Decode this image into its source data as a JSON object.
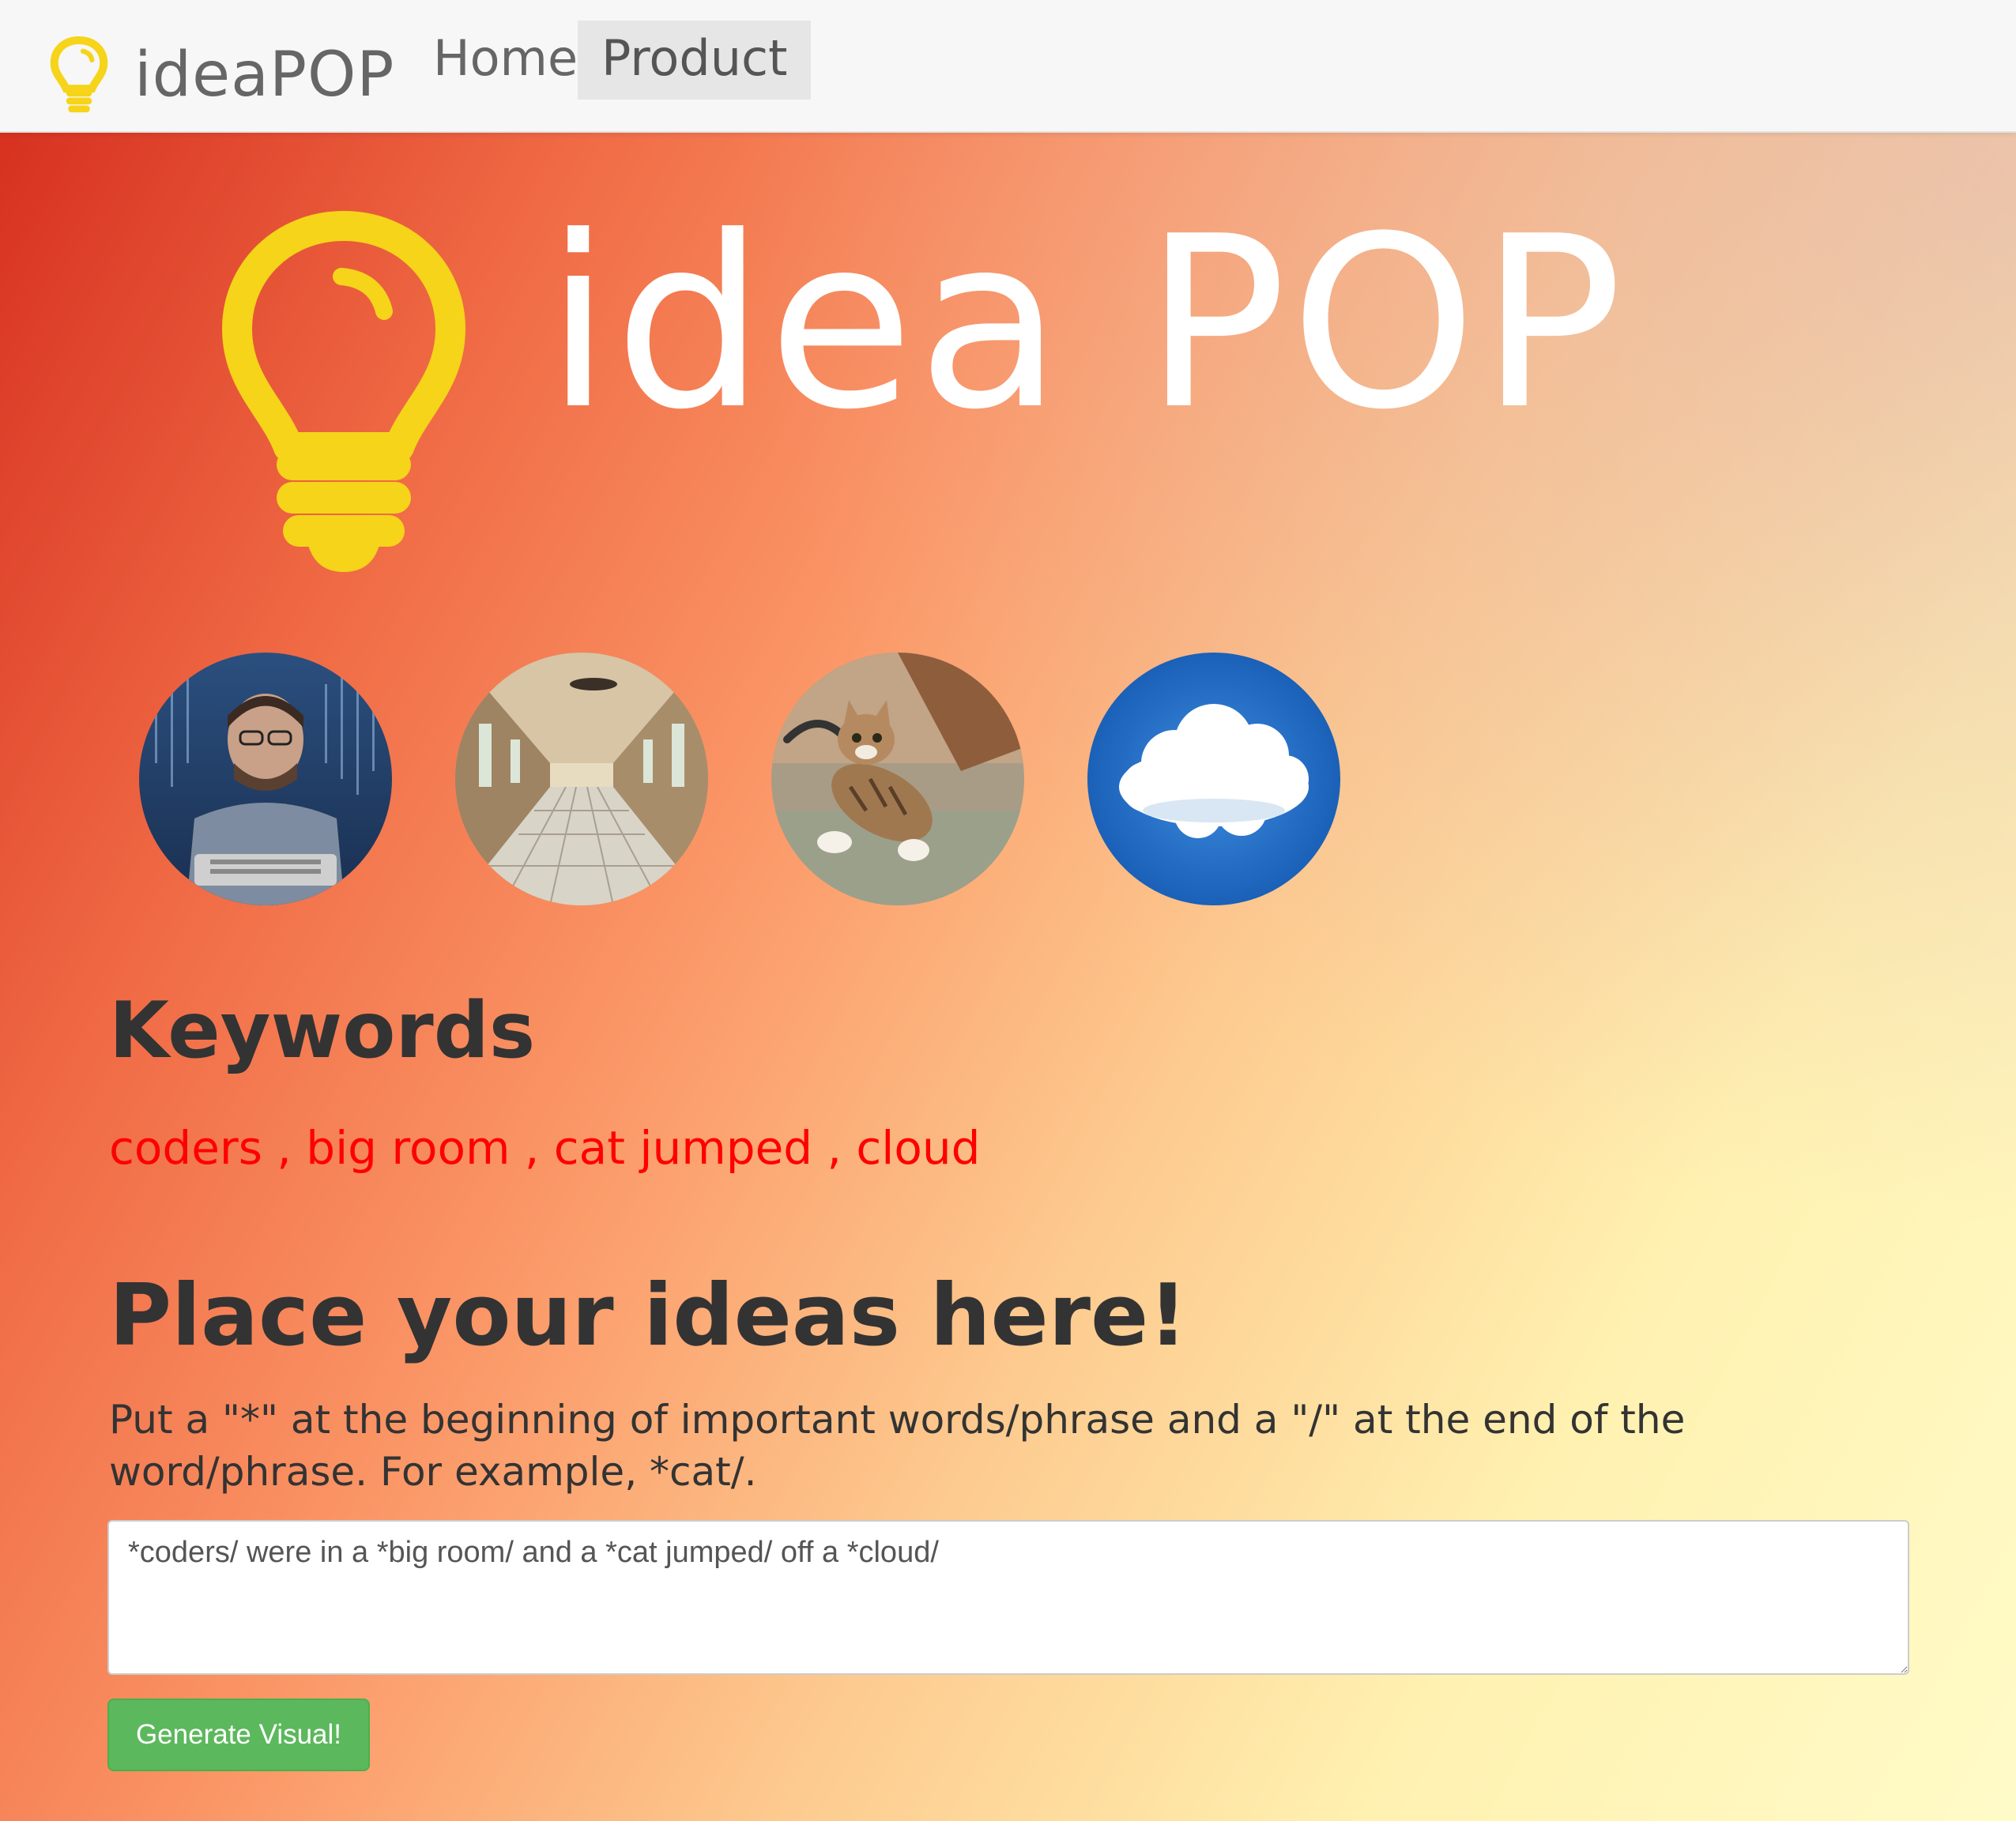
{
  "navbar": {
    "brand": "ideaPOP",
    "logo_icon": "lightbulb-icon",
    "links": [
      {
        "label": "Home",
        "active": false
      },
      {
        "label": "Product",
        "active": true
      }
    ]
  },
  "hero": {
    "title": "idea POP",
    "icon": "lightbulb-icon",
    "icon_color": "#f5d41a"
  },
  "thumbnails": [
    {
      "icon": "coder-photo"
    },
    {
      "icon": "big-room-photo"
    },
    {
      "icon": "jumping-cat-photo"
    },
    {
      "icon": "cloud-photo"
    }
  ],
  "keywords": {
    "heading": "Keywords",
    "items": [
      "coders",
      "big room",
      "cat jumped",
      "cloud"
    ],
    "separator": " , ",
    "color": "#ff0000"
  },
  "ideas": {
    "heading": "Place your ideas here!",
    "instructions": "Put a \"*\" at the beginning of important words/phrase and a \"/\" at the end of the word/phrase. For example, *cat/.",
    "textarea_value": "*coders/ were in a *big room/ and a *cat jumped/ off a *cloud/",
    "button_label": "Generate Visual!",
    "button_color": "#5cb85c"
  }
}
